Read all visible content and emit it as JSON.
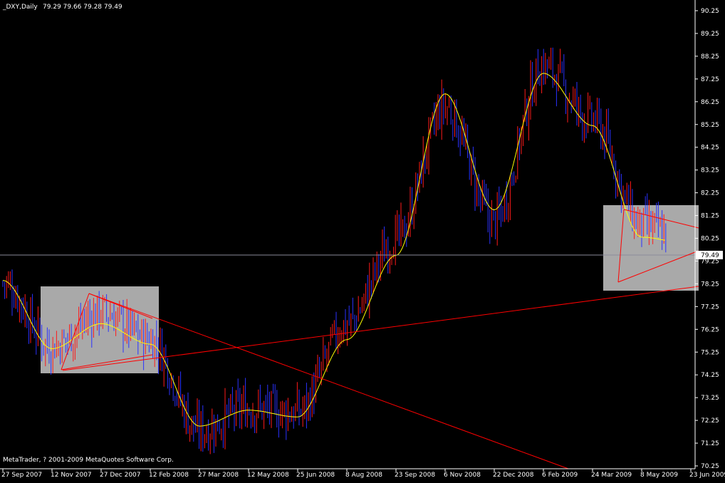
{
  "header": {
    "symbol": "_DXY,Daily",
    "quote": "79.29 79.66 79.28 79.49"
  },
  "footer": {
    "copyright": "MetaTrader, ? 2001-2009 MetaQuotes Software Corp."
  },
  "colors": {
    "background": "#000000",
    "bull_bar": "#ff1a1a",
    "bear_bar": "#2b32ff",
    "moving_average": "#ffff00",
    "trendline": "#ff0000",
    "price_line": "#8a8a9a",
    "highlight_box": "#a9a9a9",
    "axis_text": "#ffffff"
  },
  "chart_data": {
    "type": "ohlc",
    "title": "_DXY,Daily",
    "last_price": 79.49,
    "last_price_label": "79.49",
    "ylim": [
      70.25,
      90.25
    ],
    "y_ticks": [
      "90.25",
      "89.25",
      "88.25",
      "87.25",
      "86.25",
      "85.25",
      "84.25",
      "83.25",
      "82.25",
      "81.25",
      "80.25",
      "79.25",
      "78.25",
      "77.25",
      "76.25",
      "75.25",
      "74.25",
      "73.25",
      "72.25",
      "71.25",
      "70.25"
    ],
    "x_ticks": [
      "27 Sep 2007",
      "12 Nov 2007",
      "27 Dec 2007",
      "12 Feb 2008",
      "27 Mar 2008",
      "12 May 2008",
      "25 Jun 2008",
      "8 Aug 2008",
      "23 Sep 2008",
      "6 Nov 2008",
      "22 Dec 2008",
      "6 Feb 2009",
      "24 Mar 2009",
      "8 May 2009",
      "23 Jun 2009"
    ],
    "series": [
      {
        "name": "Close (approx.)",
        "style": "ohlc-bars",
        "x": [
          "27 Sep 2007",
          "12 Nov 2007",
          "27 Dec 2007",
          "12 Feb 2008",
          "27 Mar 2008",
          "12 May 2008",
          "25 Jun 2008",
          "8 Aug 2008",
          "23 Sep 2008",
          "6 Nov 2008",
          "22 Dec 2008",
          "6 Feb 2009",
          "24 Mar 2009",
          "8 May 2009",
          "23 Jun 2009"
        ],
        "values": [
          78.3,
          75.5,
          77.0,
          75.8,
          71.8,
          72.8,
          72.6,
          76.5,
          80.2,
          86.0,
          81.0,
          87.8,
          85.4,
          80.8,
          80.1
        ]
      },
      {
        "name": "Moving average (approx.)",
        "style": "line",
        "x": [
          "27 Sep 2007",
          "12 Nov 2007",
          "27 Dec 2007",
          "12 Feb 2008",
          "27 Mar 2008",
          "12 May 2008",
          "25 Jun 2008",
          "8 Aug 2008",
          "23 Sep 2008",
          "6 Nov 2008",
          "22 Dec 2008",
          "6 Feb 2009",
          "24 Mar 2009",
          "8 May 2009",
          "23 Jun 2009"
        ],
        "values": [
          78.4,
          75.4,
          76.5,
          75.6,
          72.0,
          72.7,
          72.4,
          75.8,
          79.5,
          86.6,
          81.5,
          87.5,
          85.2,
          80.3,
          80.0
        ]
      }
    ],
    "grid": false
  }
}
